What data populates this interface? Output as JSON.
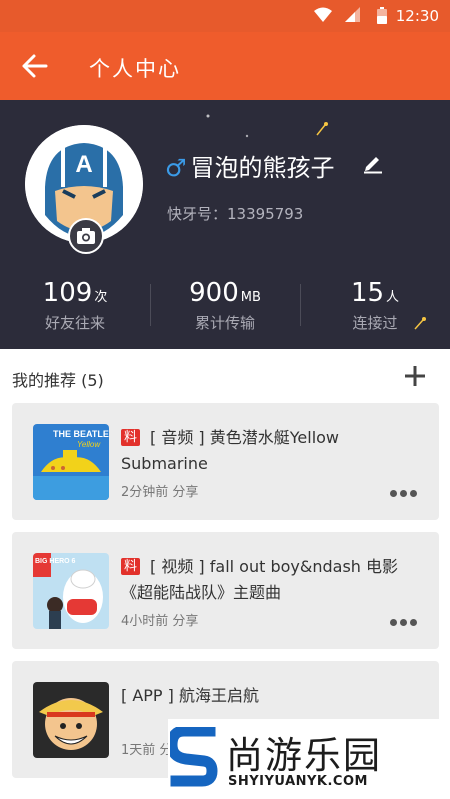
{
  "status_bar": {
    "time": "12:30"
  },
  "app_bar": {
    "title": "个人中心"
  },
  "profile": {
    "gender_symbol": "♂",
    "nickname": "冒泡的熊孩子",
    "id_label": "快牙号：13395793",
    "stats": [
      {
        "value": "109",
        "unit": "次",
        "label": "好友往来"
      },
      {
        "value": "900",
        "unit": "MB",
        "label": "累计传输"
      },
      {
        "value": "15",
        "unit": "人",
        "label": "连接过"
      }
    ]
  },
  "recommend": {
    "title": "我的推荐 (5)",
    "items": [
      {
        "tag": "料",
        "text": "[ 音频 ] 黄色潜水艇Yellow Submarine",
        "meta": "2分钟前 分享",
        "thumb_text": "THE BEATLES"
      },
      {
        "tag": "料",
        "text": "[ 视频 ] fall out boy&ndash 电影《超能陆战队》主题曲",
        "meta": "4小时前 分享",
        "thumb_text": "BIG HERO 6"
      },
      {
        "tag": "",
        "text": "[ APP ] 航海王启航",
        "meta": "1天前 分享",
        "thumb_text": ""
      }
    ]
  },
  "watermark": {
    "text": "尚游乐园",
    "url": "SHYIYUANYK.COM"
  },
  "colors": {
    "status_bar": "#e75a2c",
    "app_bar": "#ef5c2c",
    "profile_bg": "#2c2c3a",
    "tag_red": "#e2312b",
    "gender_blue": "#3b9be7"
  }
}
